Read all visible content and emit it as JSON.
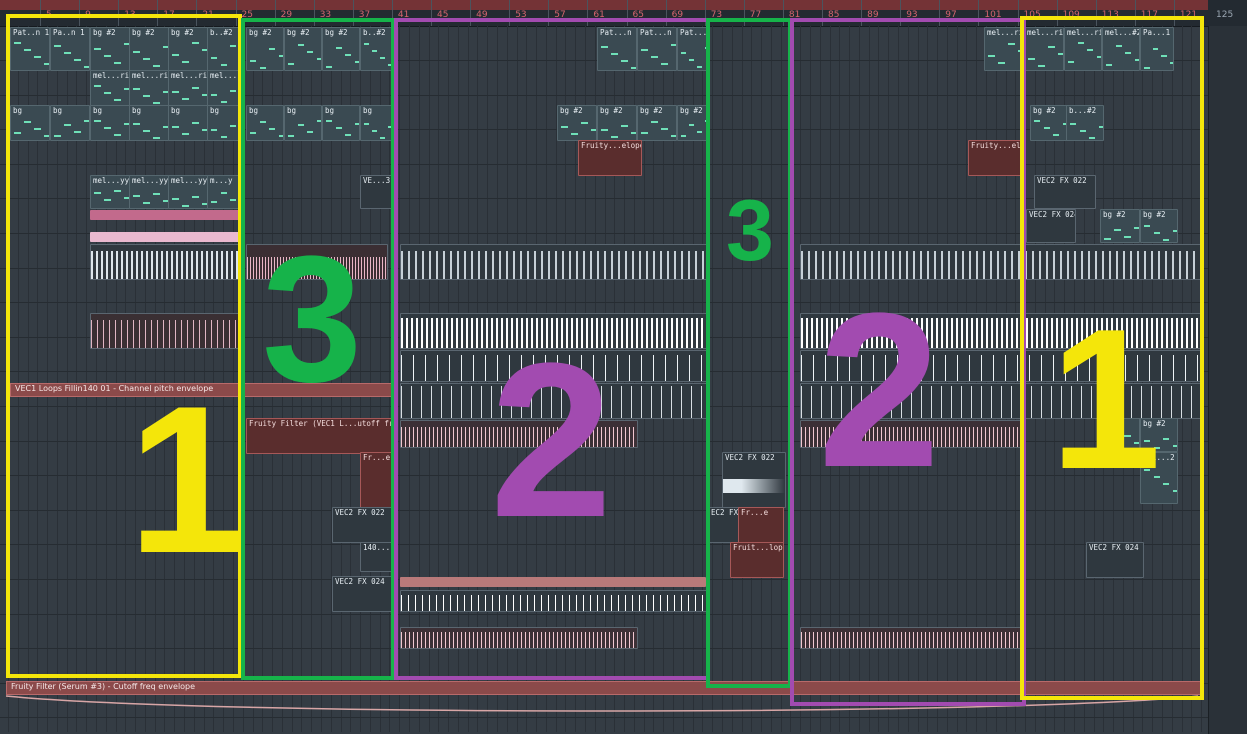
{
  "ruler": {
    "bar_numbers": [
      "5",
      "9",
      "13",
      "17",
      "21",
      "25",
      "29",
      "33",
      "37",
      "41",
      "45",
      "49",
      "53",
      "57",
      "61",
      "65",
      "69",
      "73",
      "77",
      "81",
      "85",
      "89",
      "93",
      "97",
      "101",
      "105",
      "109",
      "113",
      "117",
      "121"
    ],
    "end_marker": "125"
  },
  "clips": {
    "pattern_labels": [
      "Pat..n 1",
      "Pa..n 1",
      "bg #2",
      "bg #2",
      "bg #2",
      "b..#2",
      "bg #2",
      "bg #2",
      "bg #2",
      "b..#2"
    ],
    "melody_labels": [
      "mel...rii",
      "mel...rii",
      "mel...rii",
      "mel...rii"
    ],
    "bg_labels": [
      "bg",
      "bg",
      "bg",
      "bg",
      "bg",
      "bg",
      "bg",
      "bg",
      "bg",
      "bg",
      "bg"
    ],
    "melody_yy_labels": [
      "mel...yy",
      "mel...yy",
      "mel...yy",
      "m...y"
    ],
    "right_top_labels": [
      "mel...rii",
      "mel...rii",
      "mel...rii",
      "mel...#2",
      "Pa...1"
    ],
    "right_bg_labels": [
      "bg #2",
      "b...#2"
    ],
    "mid_pattern_labels": [
      "Pat...n 1",
      "Pat...n 1",
      "Pat..."
    ],
    "mid_bg_labels": [
      "bg #2",
      "bg #2",
      "bg #2",
      "bg #2"
    ],
    "ve_label": "VE...3",
    "fruity_elope": "Fruity...elope",
    "fruity_elop_right": "Fruity...elop",
    "vec2_fx022_right": "VEC2 FX 022",
    "vec2_fx024_right": "VEC2 FX 024",
    "right_bg2": [
      "bg #2",
      "bg #2"
    ],
    "fruity_filter_vec1": "Fruity Filter (VEC1 L...utoff freq envelope",
    "fr_e": "Fr...e",
    "vec2_fx022_left": "VEC2 FX 022",
    "label_140": "140...",
    "vec2_fx024_left": "VEC2 FX 024",
    "vec2_fx022_mid": "VEC2 FX 022",
    "ec2_fx024": "EC2 FX 024",
    "fr_e2": "Fr...e",
    "fruit_lope": "Fruit...lope",
    "right_2": "2",
    "right_bg2b": "bg #2",
    "right_mel2": "mel...2",
    "vec2_fx024_right2": "VEC2 FX 024"
  },
  "envelopes": {
    "vec1_loops": "VEC1 Loops Fillin140 01 - Channel pitch envelope",
    "serum_filter": "Fruity Filter (Serum #3) - Cutoff freq envelope"
  },
  "annotations": {
    "yellow_color": "#f4e60a",
    "green_color": "#16b34a",
    "purple_color": "#a24bb0",
    "labels": [
      "1",
      "3",
      "2",
      "3",
      "2",
      "1"
    ]
  }
}
